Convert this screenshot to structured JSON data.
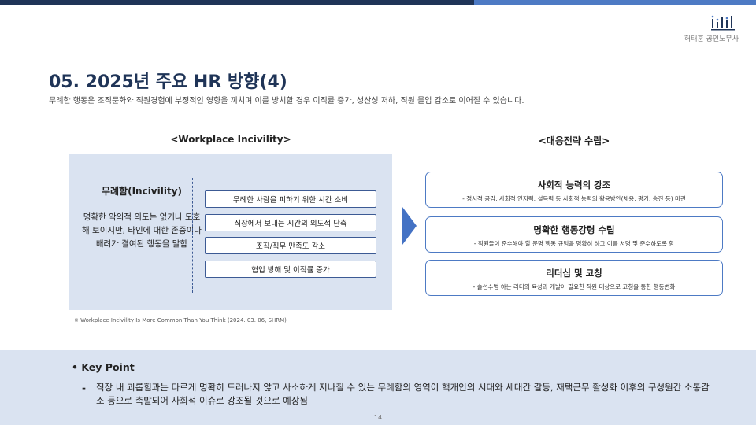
{
  "header": {
    "logo_text": "허태훈 공인노무사",
    "colors": {
      "dark_bar": "#1f3457",
      "light_bar": "#4d7ac4",
      "panel": "#dae3f1"
    }
  },
  "page": {
    "title": "05. 2025년 주요 HR 방향(4)",
    "subtitle": "무례한 행동은 조직문화와 직원경험에 부정적인 영향을 끼치며 이를 방치할 경우 이직률 증가, 생산성 저하, 직원 몰입 감소로 이어질 수 있습니다."
  },
  "left": {
    "heading": "<Workplace Incivility>",
    "term": "무례함(Incivility)",
    "description": "명확한 악의적 의도는 없거나 모호해 보이지만, 타인에 대한 존중이나 배려가 결여된 행동을 말함",
    "effects": [
      "무례한 사람을 피하기 위한 시간 소비",
      "직장에서 보내는 시간의 의도적 단축",
      "조직/직무 만족도 감소",
      "협업 방해 및 이직률 증가"
    ],
    "source": "※ Workplace Incivility Is More Common Than You Think (2024. 03. 06, SHRM)"
  },
  "right": {
    "heading": "<대응전략 수립>",
    "strategies": [
      {
        "title": "사회적 능력의 강조",
        "desc": "- 정서적 공감, 사회적 인지력, 설득력 등 사회적 능력의 활용방안(채용, 평가, 승진 등) 마련"
      },
      {
        "title": "명확한 행동강령 수립",
        "desc": "- 직원들이 준수해야 할 문명 행동 규범을 명확히 하고 이를 서명 및 준수하도록 함"
      },
      {
        "title": "리더십 및 코칭",
        "desc": "- 솔선수범 하는 리더의 육성과 개발이 필요한 직원 대상으로 코칭을 통한 행동변화"
      }
    ]
  },
  "keypoint": {
    "title": "• Key Point",
    "bullet": "-",
    "text": "직장 내 괴롭힘과는 다르게 명확히 드러나지 않고 사소하게 지나칠 수 있는 무례함의 영역이 핵개인의 시대와 세대간 갈등, 재택근무 활성화 이후의 구성원간 소통감소 등으로 촉발되어 사회적 이슈로 강조될 것으로 예상됨"
  },
  "page_number": "14"
}
